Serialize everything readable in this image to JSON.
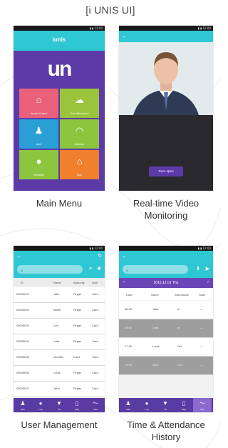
{
  "header": {
    "title": "[i UNIS UI]"
  },
  "colors": {
    "teal": "#2ec7d3",
    "purple": "#5a3aa3",
    "pink": "#e8607a",
    "green": "#9ac43c",
    "blue": "#2a9fd6",
    "orange": "#f07f2e",
    "lime": "#8cc63e"
  },
  "main_menu": {
    "caption": "Main Menu",
    "brand": "iunis",
    "logo": "un",
    "tiles": [
      {
        "label": "Access Control",
        "icon": "home-lock-icon"
      },
      {
        "label": "Time Attendance",
        "icon": "cloud-icon"
      },
      {
        "label": "User",
        "icon": "user-icon"
      },
      {
        "label": "Network",
        "icon": "wifi-icon"
      },
      {
        "label": "Message",
        "icon": "chat-icon"
      },
      {
        "label": "Door",
        "icon": "door-icon"
      }
    ]
  },
  "video": {
    "caption_line1": "Real-time Video",
    "caption_line2": "Monitoring",
    "button_label": "Door open"
  },
  "user_mgmt": {
    "caption": "User Management",
    "columns": [
      "ID",
      "Name",
      "Authority",
      "Auth"
    ],
    "rows": [
      [
        "00000001",
        "Jake",
        "Finger",
        "Card"
      ],
      [
        "00000002",
        "Marie",
        "Finger",
        "Card"
      ],
      [
        "00000003",
        "Lee",
        "Finger",
        "Card"
      ],
      [
        "00000004",
        "Leila",
        "Finger",
        "Card"
      ],
      [
        "00000005",
        "Jennifer",
        "Card",
        "Card"
      ],
      [
        "00000006",
        "Louis",
        "Finger",
        "Card"
      ],
      [
        "00000007",
        "John",
        "Finger",
        "Card"
      ]
    ],
    "tabs": [
      "User",
      "Log",
      "TA",
      "Msg",
      "Stat"
    ]
  },
  "ta_history": {
    "caption_line1": "Time & Attendance",
    "caption_line2": "History",
    "date": "2015.12.01 Thu",
    "columns": [
      "Date",
      "Name",
      "Attendance",
      "State"
    ],
    "rows": [
      [
        "08:30",
        "Jake",
        "In",
        "—"
      ],
      [
        "08:42",
        "Leila",
        "In",
        "—"
      ],
      [
        "17:10",
        "Louis",
        "Out",
        "—"
      ],
      [
        "18:05",
        "John",
        "Out",
        "—"
      ]
    ],
    "tabs": [
      "User",
      "Log",
      "TA",
      "Msg",
      "Stat"
    ]
  }
}
